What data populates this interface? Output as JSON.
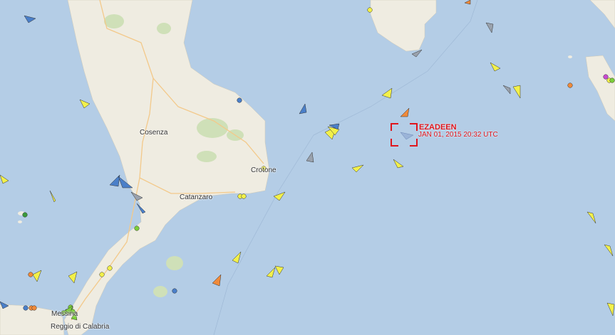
{
  "map": {
    "cities": [
      {
        "key": "cosenza",
        "name": "Cosenza"
      },
      {
        "key": "catanzaro",
        "name": "Catanzaro"
      },
      {
        "key": "crotone",
        "name": "Crotone"
      },
      {
        "key": "messina",
        "name": "Messina"
      },
      {
        "key": "reggio",
        "name": "Reggio di Calabria"
      }
    ],
    "selected_vessel": {
      "name": "EZADEEN",
      "timestamp": "JAN 01, 2015 20:32 UTC"
    },
    "colors": {
      "sea": "#b4cde6",
      "land": "#efece1",
      "cargo": "#f2f04a",
      "passenger": "#4a7fc9",
      "tanker": "#f08a3a",
      "unspecified": "#9aa2ad",
      "highlight": "#e0151b"
    }
  }
}
